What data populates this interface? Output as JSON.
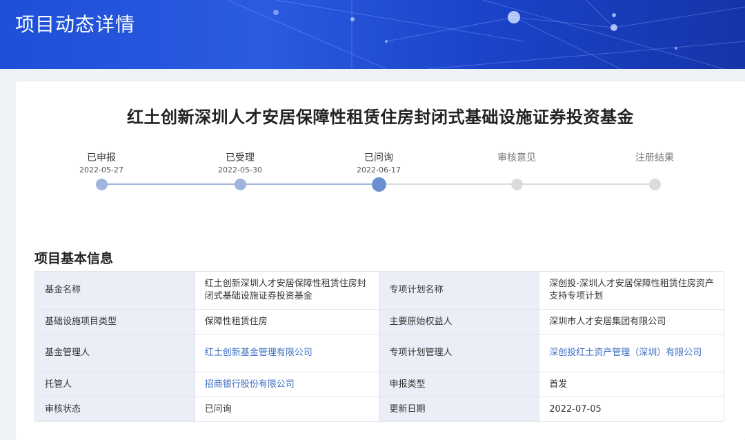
{
  "header": {
    "title": "项目动态详情"
  },
  "fund": {
    "title": "红土创新深圳人才安居保障性租赁住房封闭式基础设施证券投资基金"
  },
  "progress": {
    "steps": [
      {
        "label": "已申报",
        "date": "2022-05-27",
        "status": "done"
      },
      {
        "label": "已受理",
        "date": "2022-05-30",
        "status": "done"
      },
      {
        "label": "已问询",
        "date": "2022-06-17",
        "status": "current"
      },
      {
        "label": "审核意见",
        "date": "",
        "status": "pending"
      },
      {
        "label": "注册结果",
        "date": "",
        "status": "pending"
      }
    ]
  },
  "info": {
    "section_title": "项目基本信息",
    "rows": [
      [
        "基金名称",
        "红土创新深圳人才安居保障性租赁住房封闭式基础设施证券投资基金",
        "专项计划名称",
        "深创投-深圳人才安居保障性租赁住房资产支持专项计划"
      ],
      [
        "基础设施项目类型",
        "保障性租赁住房",
        "主要原始权益人",
        "深圳市人才安居集团有限公司"
      ],
      [
        "基金管理人",
        "红土创新基金管理有限公司",
        "专项计划管理人",
        "深创投红土资产管理（深圳）有限公司"
      ],
      [
        "托管人",
        "招商银行股份有限公司",
        "申报类型",
        "首发"
      ],
      [
        "审核状态",
        "已问询",
        "更新日期",
        "2022-07-05"
      ]
    ]
  },
  "colors": {
    "banner": "#1e4fd8",
    "progress_done": "#9fb5de",
    "progress_current": "#6b8fd0",
    "progress_pending": "#dcdcdc",
    "link": "#3d6fc2",
    "table_key_bg": "#eaeff7"
  }
}
